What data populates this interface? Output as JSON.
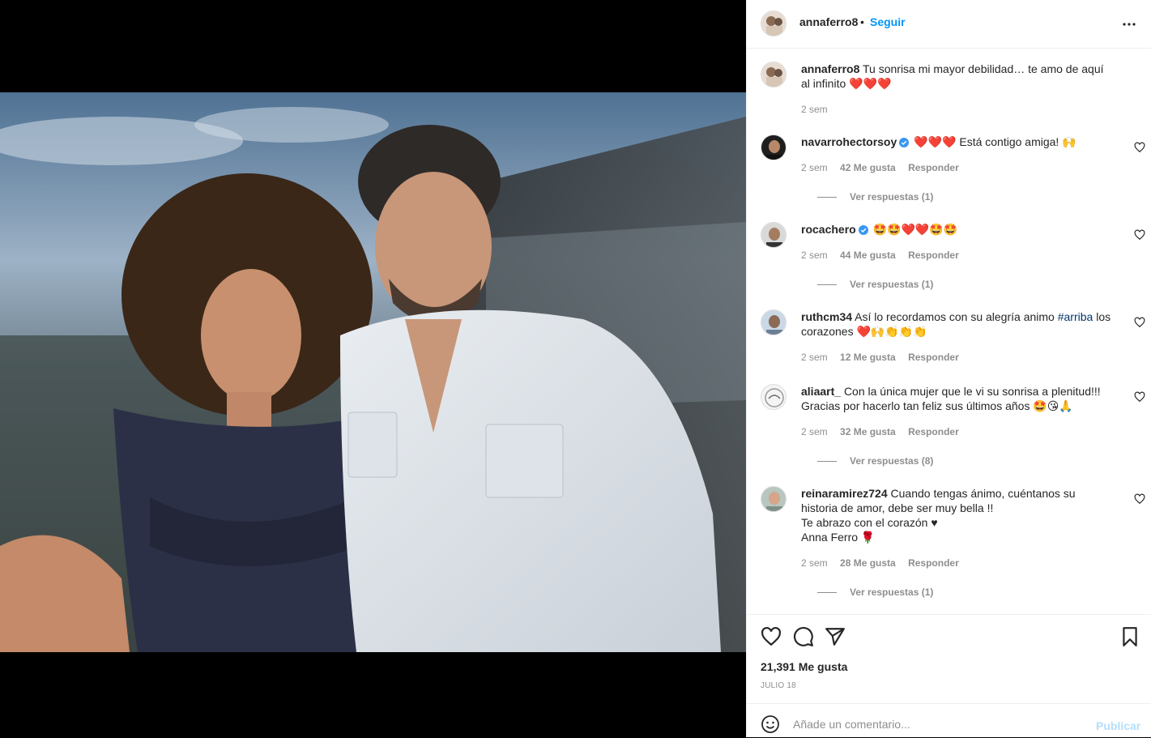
{
  "header": {
    "username": "annaferro8",
    "separator": "•",
    "follow_label": "Seguir",
    "more_icon": "more-horizontal-icon"
  },
  "caption": {
    "username": "annaferro8",
    "text": "Tu sonrisa mi mayor debilidad… te amo de aquí al infinito ❤️❤️❤️",
    "time": "2 sem"
  },
  "comments": [
    {
      "username": "navarrohectorsoy",
      "verified": true,
      "text": "❤️❤️❤️ Está contigo amiga! 🙌",
      "time": "2 sem",
      "likes": "42 Me gusta",
      "reply": "Responder",
      "replies": "Ver respuestas (1)"
    },
    {
      "username": "rocachero",
      "verified": true,
      "text": "🤩🤩❤️❤️🤩🤩",
      "time": "2 sem",
      "likes": "44 Me gusta",
      "reply": "Responder",
      "replies": "Ver respuestas (1)"
    },
    {
      "username": "ruthcm34",
      "verified": false,
      "text_before": "Así lo recordamos con su alegría animo ",
      "hashtag": "#arriba",
      "text_after": " los corazones ❤️🙌👏👏👏",
      "time": "2 sem",
      "likes": "12 Me gusta",
      "reply": "Responder"
    },
    {
      "username": "aliaart_",
      "verified": false,
      "text": "Con la única mujer que le vi su sonrisa a plenitud!!! Gracias por hacerlo tan feliz sus últimos años 🤩😘🙏",
      "time": "2 sem",
      "likes": "32 Me gusta",
      "reply": "Responder",
      "replies": "Ver respuestas (8)"
    },
    {
      "username": "reinaramirez724",
      "verified": false,
      "text": "Cuando tengas ánimo, cuéntanos su historia de amor, debe ser muy bella !!",
      "line2": "Te abrazo con el corazón ♥",
      "line3": "Anna Ferro 🌹",
      "time": "2 sem",
      "likes": "28 Me gusta",
      "reply": "Responder",
      "replies": "Ver respuestas (1)"
    }
  ],
  "actions": {
    "like_icon": "heart-icon",
    "comment_icon": "comment-icon",
    "share_icon": "send-icon",
    "save_icon": "bookmark-icon",
    "likes": "21,391 Me gusta",
    "date": "JULIO 18"
  },
  "add_comment": {
    "placeholder": "Añade un comentario...",
    "publish_label": "Publicar",
    "emoji_icon": "emoji-icon"
  },
  "colors": {
    "accent": "#0095f6",
    "muted": "#8e8e8e",
    "publish_disabled": "#b2dffc",
    "verified": "#3897f0"
  }
}
